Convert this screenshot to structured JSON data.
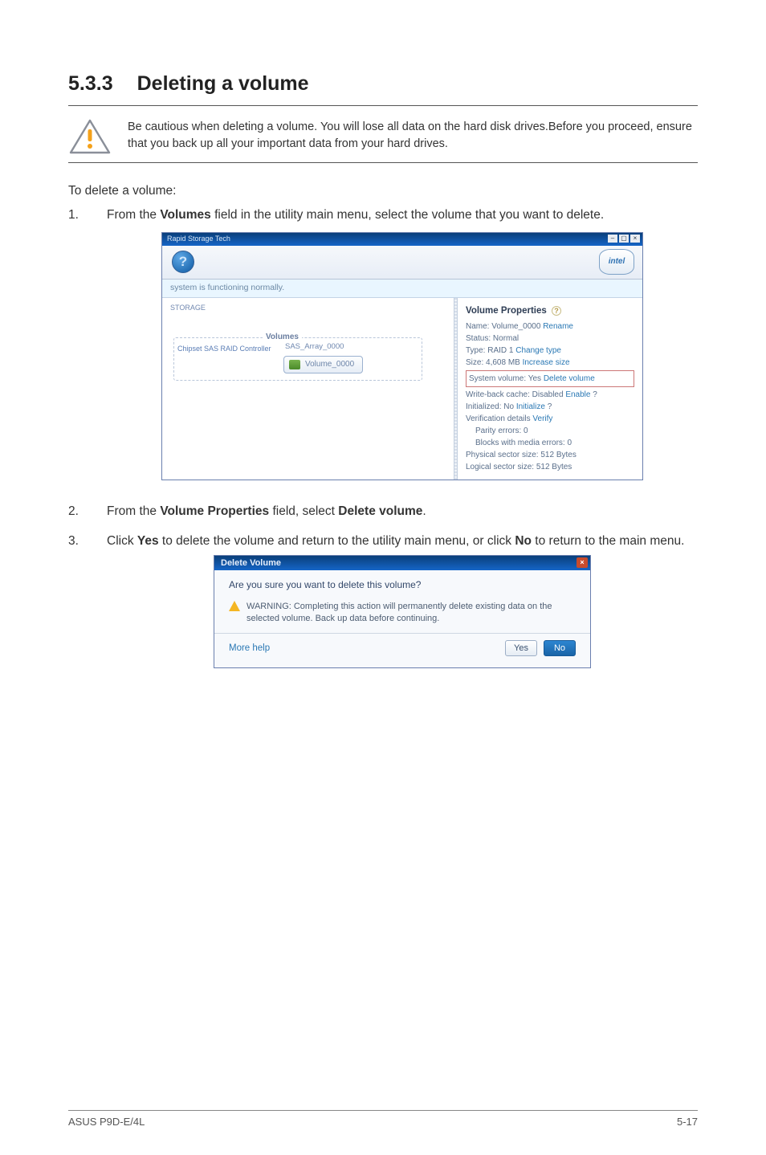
{
  "section": {
    "number": "5.3.3",
    "title": "Deleting a volume"
  },
  "callout": {
    "text": "Be cautious when deleting a volume. You will lose all data on the hard disk drives.Before you proceed, ensure that you back up all your important data from your hard drives."
  },
  "intro": "To delete a volume:",
  "steps": {
    "s1_a": "From the ",
    "s1_b_bold": "Volumes",
    "s1_c": " field in the utility main menu, select the volume that you want to delete.",
    "s2_a": "From the ",
    "s2_b_bold": "Volume Properties",
    "s2_c": " field, select ",
    "s2_d_bold": "Delete volume",
    "s2_e": ".",
    "s3_a": "Click ",
    "s3_b_bold": "Yes",
    "s3_c": " to delete the volume and return to the utility main menu, or click ",
    "s3_d_bold": "No",
    "s3_e": " to return to the main menu."
  },
  "app": {
    "title": "Rapid Storage Tech",
    "help_glyph": "?",
    "intel": "intel",
    "status": "system is functioning normally.",
    "left": {
      "storage_label": "STORAGE",
      "volumes": "Volumes",
      "controller": "Chipset SAS RAID Controller",
      "array": "SAS_Array_0000",
      "volume_chip": "Volume_0000"
    },
    "right": {
      "header": "Volume Properties",
      "name": "Name: Volume_0000",
      "rename": "Rename",
      "status": "Status: Normal",
      "type": "Type: RAID 1",
      "change_type": "Change type",
      "size": "Size: 4,608 MB",
      "increase": "Increase size",
      "sysvol": "System volume: Yes",
      "delete_vol": "Delete volume",
      "wb": "Write-back cache: Disabled",
      "wb_enable": "Enable",
      "init": "Initialized: No",
      "init_link": "Initialize",
      "verif": "Verification details",
      "verify": "Verify",
      "parity": "Parity errors: 0",
      "blocks": "Blocks with media errors: 0",
      "psec": "Physical sector size: 512 Bytes",
      "lsec": "Logical sector size: 512 Bytes"
    }
  },
  "dialog": {
    "title": "Delete Volume",
    "question": "Are you sure you want to delete this volume?",
    "warning": "WARNING: Completing this action will permanently delete existing data on the selected volume. Back up data before continuing.",
    "help": "More help",
    "yes": "Yes",
    "no": "No",
    "close_glyph": "×"
  },
  "footer": {
    "left": "ASUS P9D-E/4L",
    "right": "5-17"
  }
}
